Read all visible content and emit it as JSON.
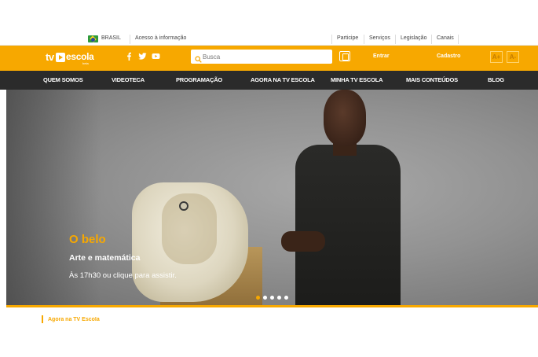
{
  "gov_bar": {
    "country": "BRASIL",
    "info_access": "Acesso à informação",
    "links": [
      "Participe",
      "Serviços",
      "Legislação",
      "Canais"
    ]
  },
  "header": {
    "logo": {
      "tv": "tv",
      "escola": "escola",
      "sub": "beta"
    },
    "social": [
      "facebook-icon",
      "twitter-icon",
      "youtube-icon"
    ],
    "search_placeholder": "Busca",
    "login_label": "Entrar",
    "signup_label": "Cadastro",
    "font_increase": "A+",
    "font_decrease": "A-"
  },
  "nav": {
    "items": [
      "QUEM SOMOS",
      "VIDEOTECA",
      "PROGRAMAÇÃO",
      "AGORA NA TV ESCOLA",
      "MINHA TV ESCOLA",
      "MAIS CONTEÚDOS",
      "BLOG"
    ]
  },
  "hero": {
    "title": "O belo",
    "subtitle": "Arte e matemática",
    "description": "Às 17h30 ou clique para assistir.",
    "slide_count": 5,
    "active_slide": 1
  },
  "section": {
    "title": "Agora na TV Escola"
  },
  "colors": {
    "accent": "#f7a800",
    "nav_bg": "#2b2b2b"
  }
}
